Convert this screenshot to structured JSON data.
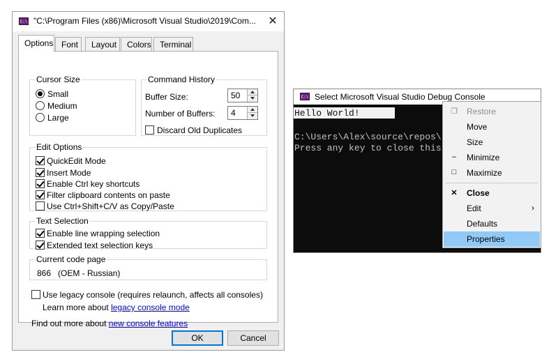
{
  "dialog": {
    "title": "\"C:\\Program Files (x86)\\Microsoft Visual Studio\\2019\\Com...",
    "tabs": [
      "Options",
      "Font",
      "Layout",
      "Colors",
      "Terminal"
    ],
    "active_tab": "Options",
    "cursor_size": {
      "legend": "Cursor Size",
      "options": [
        "Small",
        "Medium",
        "Large"
      ],
      "selected": "Small"
    },
    "command_history": {
      "legend": "Command History",
      "buffer_size_label": "Buffer Size:",
      "buffer_size_value": "50",
      "num_buffers_label": "Number of Buffers:",
      "num_buffers_value": "4",
      "discard_label": "Discard Old Duplicates",
      "discard_checked": false
    },
    "edit_options": {
      "legend": "Edit Options",
      "items": [
        {
          "label": "QuickEdit Mode",
          "checked": true
        },
        {
          "label": "Insert Mode",
          "checked": true
        },
        {
          "label": "Enable Ctrl key shortcuts",
          "checked": true
        },
        {
          "label": "Filter clipboard contents on paste",
          "checked": true
        },
        {
          "label": "Use Ctrl+Shift+C/V as Copy/Paste",
          "checked": false
        }
      ]
    },
    "text_selection": {
      "legend": "Text Selection",
      "items": [
        {
          "label": "Enable line wrapping selection",
          "checked": true
        },
        {
          "label": "Extended text selection keys",
          "checked": true
        }
      ]
    },
    "code_page": {
      "legend": "Current code page",
      "value": "866   (OEM - Russian)"
    },
    "legacy_console_label": "Use legacy console (requires relaunch, affects all consoles)",
    "legacy_console_checked": false,
    "learn_more_prefix": "Learn more about ",
    "learn_more_link": "legacy console mode",
    "find_out_prefix": "Find out more about ",
    "find_out_link": "new console features",
    "ok_label": "OK",
    "cancel_label": "Cancel"
  },
  "console": {
    "title": "Select Microsoft Visual Studio Debug Console",
    "lines": [
      "Hello World!",
      "",
      "C:\\Users\\Alex\\source\\repos\\",
      "Press any key to close this"
    ]
  },
  "system_menu": {
    "items": [
      {
        "label": "Restore",
        "glyph": "❐",
        "disabled": true
      },
      {
        "label": "Move",
        "glyph": ""
      },
      {
        "label": "Size",
        "glyph": ""
      },
      {
        "label": "Minimize",
        "glyph": "–"
      },
      {
        "label": "Maximize",
        "glyph": "□"
      },
      {
        "label": "Close",
        "glyph": "✕",
        "bold": true
      },
      {
        "label": "Edit",
        "glyph": "",
        "submenu": "›"
      },
      {
        "label": "Defaults",
        "glyph": ""
      },
      {
        "label": "Properties",
        "glyph": "",
        "highlighted": true
      }
    ]
  },
  "app_icon_text": "C:\\",
  "colors": {
    "annotation_arrow": "#e8191d",
    "menu_highlight": "#91c9f7",
    "console_bg": "#0c0c0c",
    "default_button_border": "#0078d7"
  }
}
